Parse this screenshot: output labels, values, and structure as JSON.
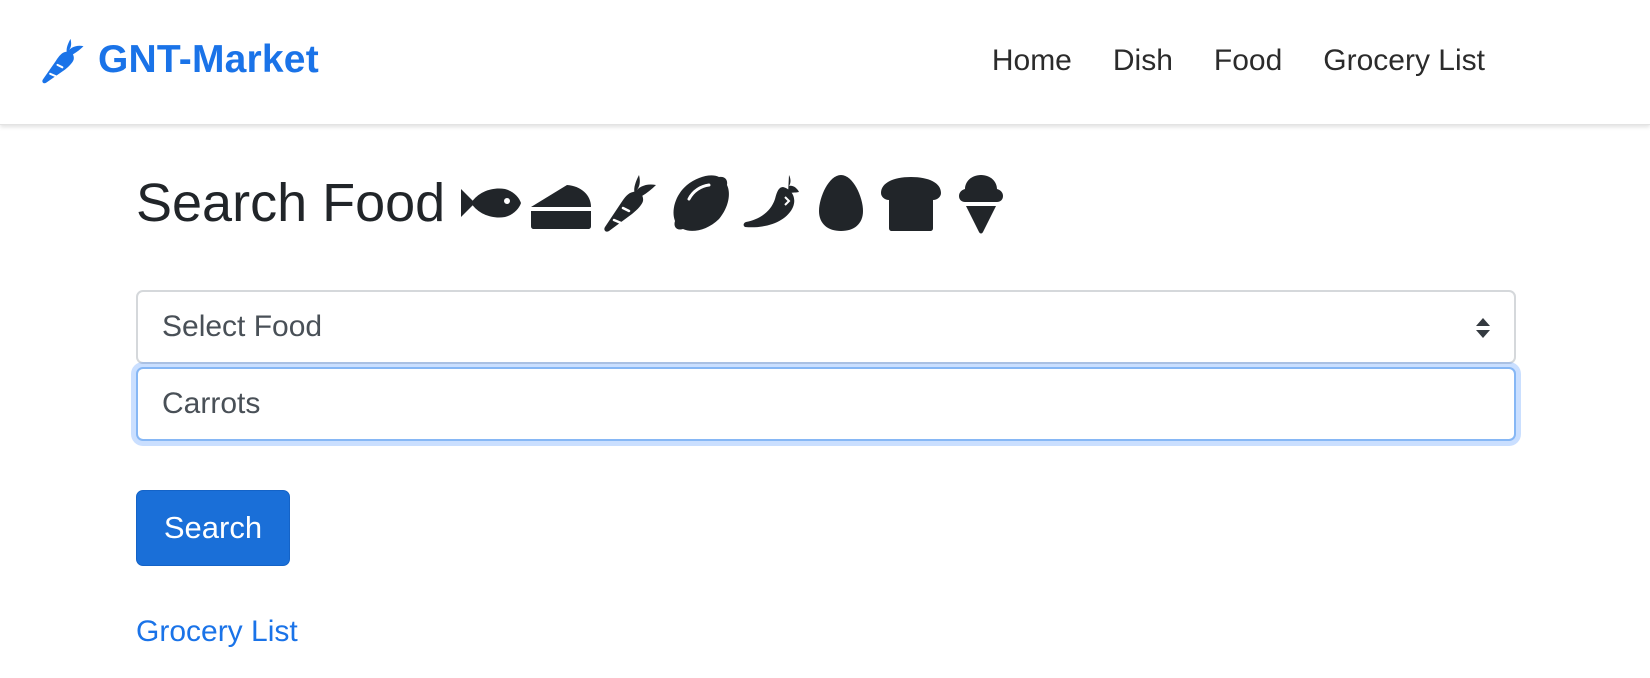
{
  "brand": {
    "name": "GNT-Market",
    "icon": "carrot-icon",
    "color": "#1a73e8"
  },
  "nav": {
    "items": [
      {
        "label": "Home"
      },
      {
        "label": "Dish"
      },
      {
        "label": "Food"
      },
      {
        "label": "Grocery List"
      }
    ]
  },
  "main": {
    "title": "Search Food",
    "title_icons": [
      "fish-icon",
      "cheese-icon",
      "carrot-icon",
      "lemon-icon",
      "pepper-icon",
      "egg-icon",
      "bread-icon",
      "ice-cream-icon"
    ],
    "select": {
      "value": "Select Food"
    },
    "input": {
      "value": "Carrots"
    },
    "search_button_label": "Search",
    "grocery_link": "Grocery List"
  },
  "colors": {
    "primary": "#1a6fd8",
    "link": "#1a73e8",
    "focus_border": "#86b7f5"
  }
}
